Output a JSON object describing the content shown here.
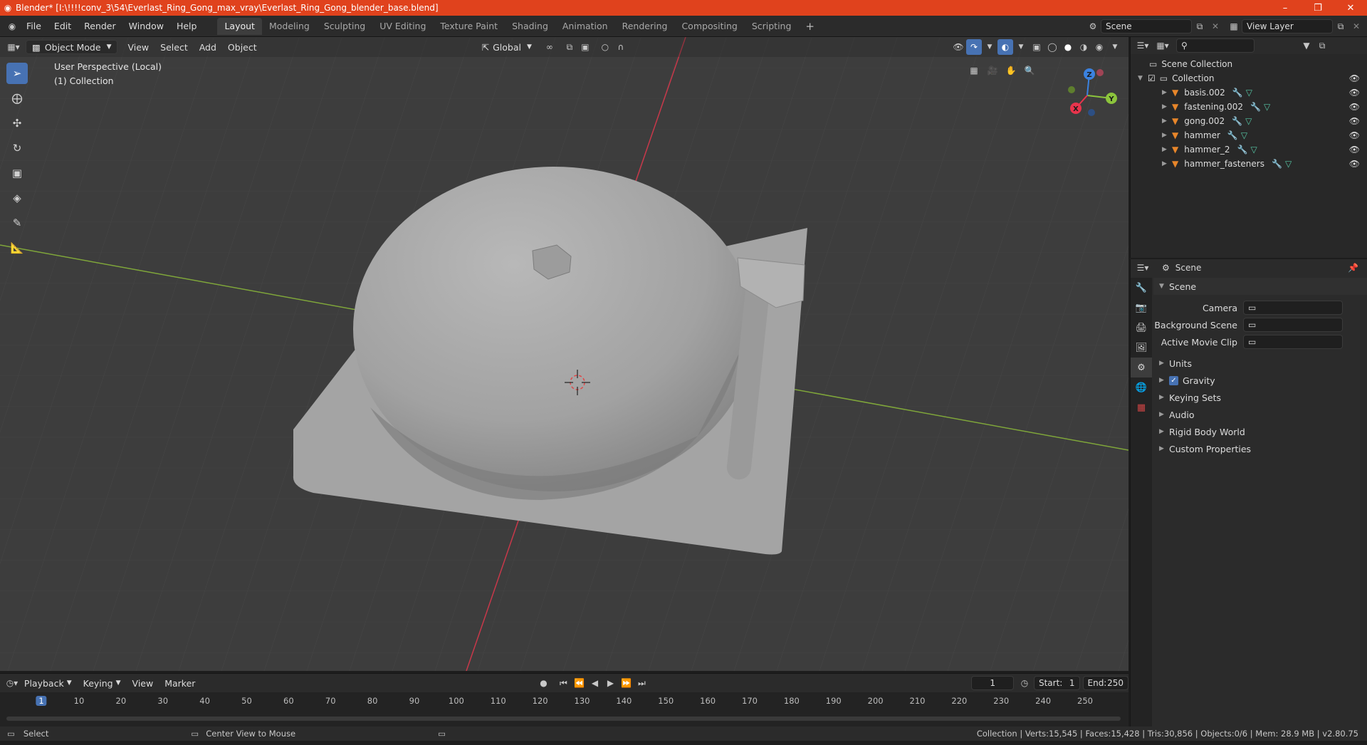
{
  "window": {
    "title": "Blender* [I:\\!!!!conv_3\\54\\Everlast_Ring_Gong_max_vray\\Everlast_Ring_Gong_blender_base.blend]",
    "minimize": "–",
    "maximize": "❐",
    "close": "✕"
  },
  "menu": [
    "File",
    "Edit",
    "Render",
    "Window",
    "Help"
  ],
  "workspaces": [
    "Layout",
    "Modeling",
    "Sculpting",
    "UV Editing",
    "Texture Paint",
    "Shading",
    "Animation",
    "Rendering",
    "Compositing",
    "Scripting"
  ],
  "workspace_active": "Layout",
  "scene_field": "Scene",
  "view_layer_field": "View Layer",
  "viewport": {
    "mode": "Object Mode",
    "menus": [
      "View",
      "Select",
      "Add",
      "Object"
    ],
    "orientation": "Global",
    "info_line1": "User Perspective (Local)",
    "info_line2": "(1) Collection",
    "gizmo": {
      "x": "X",
      "y": "Y",
      "z": "Z"
    }
  },
  "outliner": {
    "root": "Scene Collection",
    "collection": "Collection",
    "items": [
      "basis.002",
      "fastening.002",
      "gong.002",
      "hammer",
      "hammer_2",
      "hammer_fasteners"
    ]
  },
  "properties": {
    "header": "Scene",
    "section": "Scene",
    "fields": [
      {
        "label": "Camera",
        "value": ""
      },
      {
        "label": "Background Scene",
        "value": ""
      },
      {
        "label": "Active Movie Clip",
        "value": ""
      }
    ],
    "panels": [
      "Units",
      "Gravity",
      "Keying Sets",
      "Audio",
      "Rigid Body World",
      "Custom Properties"
    ],
    "gravity_checked": true
  },
  "timeline": {
    "menus": [
      "Playback",
      "Keying",
      "View",
      "Marker"
    ],
    "current_frame": "1",
    "start_label": "Start:",
    "start": "1",
    "end_label": "End:",
    "end": "250",
    "ticks": [
      "1",
      "10",
      "20",
      "30",
      "40",
      "50",
      "60",
      "70",
      "80",
      "90",
      "100",
      "110",
      "120",
      "130",
      "140",
      "150",
      "160",
      "170",
      "180",
      "190",
      "200",
      "210",
      "220",
      "230",
      "240",
      "250"
    ]
  },
  "status": {
    "left1": "Select",
    "left2": "Center View to Mouse",
    "right": "Collection | Verts:15,545 | Faces:15,428 | Tris:30,856 | Objects:0/6 | Mem: 28.9 MB | v2.80.75"
  },
  "colors": {
    "title_bar": "#e0421d",
    "accent": "#4772b3",
    "x_axis": "#e8344c",
    "y_axis": "#8cc43c",
    "z_axis": "#3b82e0",
    "object_orange": "#e8862a"
  }
}
